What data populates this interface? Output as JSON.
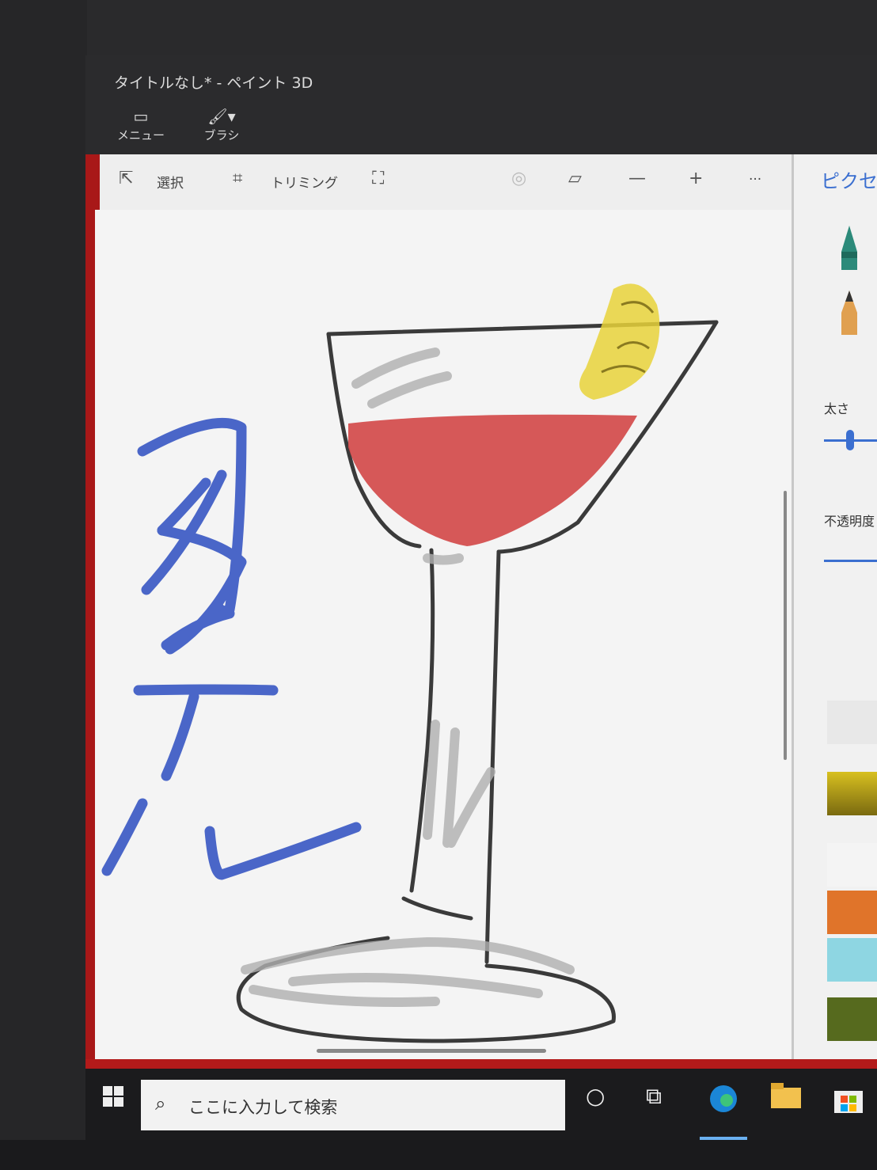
{
  "window": {
    "title": "タイトルなし* - ペイント 3D"
  },
  "ribbon": {
    "menu_label": "メニュー",
    "brush_label": "ブラシ"
  },
  "toolbar": {
    "select_label": "選択",
    "trim_label": "トリミング",
    "more_label": "···"
  },
  "canvas": {
    "drawn_text": "カクテル",
    "subject": "cocktail glass drawing with red drink and lemon garnish"
  },
  "side_panel": {
    "title": "ピクセ",
    "thickness_label": "太さ",
    "opacity_label": "不透明度"
  },
  "colors": {
    "canvas": "#f4f4f4",
    "ink_blue": "#4a66c8",
    "drink_red": "#d24a4a",
    "lemon_yellow": "#e8d23a",
    "glass_gray": "#b0b0b0",
    "accent_blue": "#3b6fd0",
    "swatch_gold": "#c9a818",
    "swatch_white": "#f4f4f4",
    "swatch_orange": "#e0742a",
    "swatch_cyan": "#8ed6e2",
    "swatch_olive": "#566a1e"
  },
  "taskbar": {
    "search_placeholder": "ここに入力して検索"
  }
}
